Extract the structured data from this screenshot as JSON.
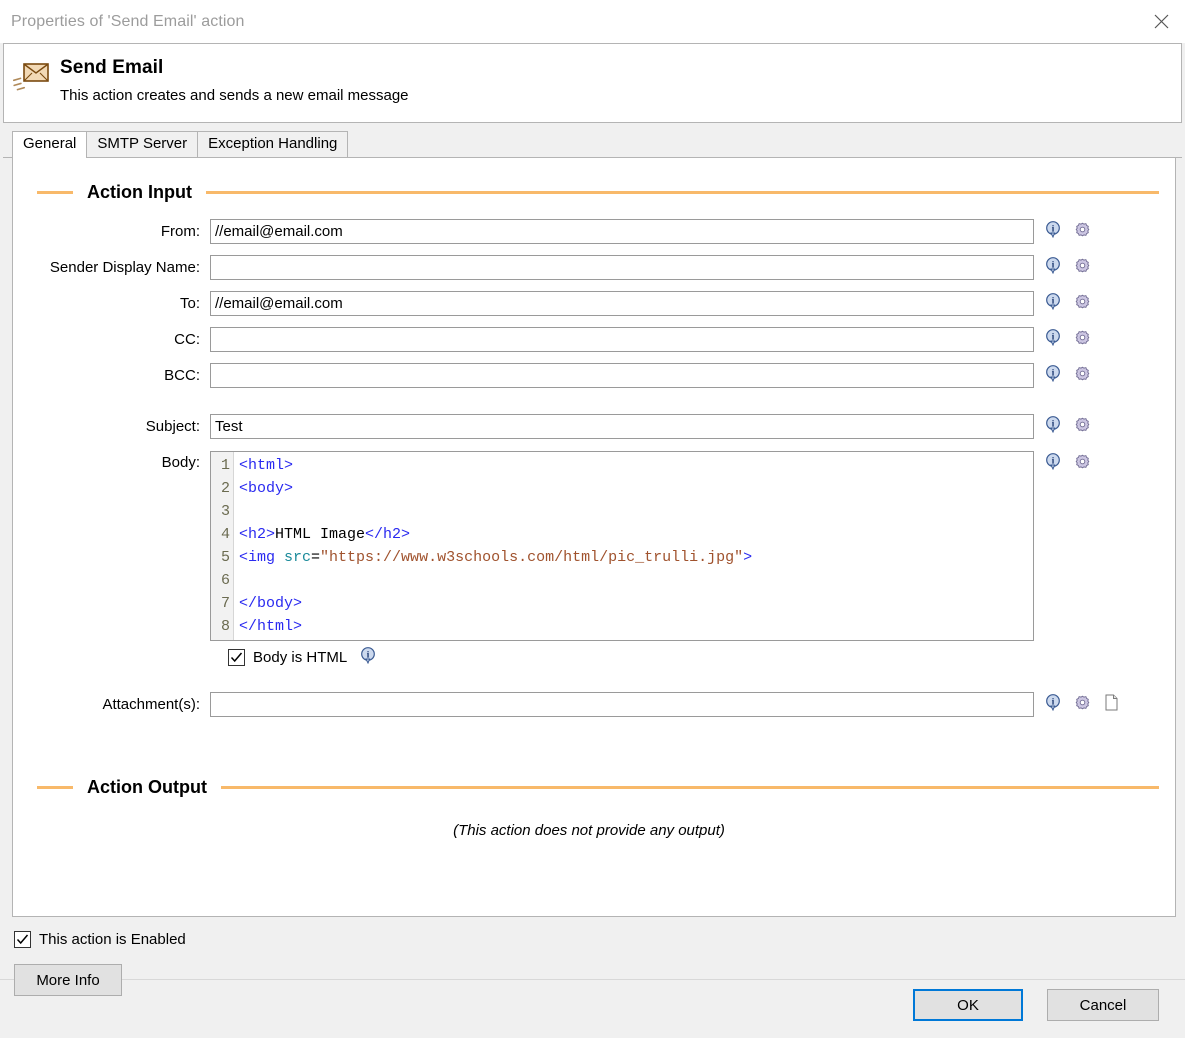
{
  "window": {
    "title": "Properties of 'Send Email' action",
    "close_label": "Close"
  },
  "header": {
    "icon": "send-email-envelope-icon",
    "title": "Send Email",
    "description": "This action creates and sends a new email message"
  },
  "tabs": [
    {
      "label": "General",
      "active": true
    },
    {
      "label": "SMTP Server",
      "active": false
    },
    {
      "label": "Exception Handling",
      "active": false
    }
  ],
  "action_input": {
    "section_title": "Action Input",
    "fields": [
      {
        "label": "From:",
        "value": "//email@email.com",
        "placeholder": "",
        "name": "from"
      },
      {
        "label": "Sender Display Name:",
        "value": "",
        "placeholder": "",
        "name": "sender-display-name"
      },
      {
        "label": "To:",
        "value": "//email@email.com",
        "placeholder": "",
        "name": "to"
      },
      {
        "label": "CC:",
        "value": "",
        "placeholder": "",
        "name": "cc"
      },
      {
        "label": "BCC:",
        "value": "",
        "placeholder": "",
        "name": "bcc"
      }
    ],
    "subject": {
      "label": "Subject:",
      "value": "Test",
      "placeholder": ""
    },
    "body": {
      "label": "Body:",
      "lines": [
        {
          "n": "1",
          "tokens": [
            {
              "t": "tag",
              "s": "<html>"
            }
          ]
        },
        {
          "n": "2",
          "tokens": [
            {
              "t": "tag",
              "s": "<body>"
            }
          ]
        },
        {
          "n": "3",
          "tokens": []
        },
        {
          "n": "4",
          "tokens": [
            {
              "t": "tag",
              "s": "<h2>"
            },
            {
              "t": "plain",
              "s": "HTML Image"
            },
            {
              "t": "tag",
              "s": "</h2>"
            }
          ]
        },
        {
          "n": "5",
          "tokens": [
            {
              "t": "tag",
              "s": "<img "
            },
            {
              "t": "attr",
              "s": "src"
            },
            {
              "t": "eq",
              "s": "="
            },
            {
              "t": "str",
              "s": "\"https://www.w3schools.com/html/pic_trulli.jpg\""
            },
            {
              "t": "tag",
              "s": ">"
            }
          ]
        },
        {
          "n": "6",
          "tokens": []
        },
        {
          "n": "7",
          "tokens": [
            {
              "t": "tag",
              "s": "</body>"
            }
          ]
        },
        {
          "n": "8",
          "tokens": [
            {
              "t": "tag",
              "s": "</html>"
            }
          ]
        }
      ]
    },
    "body_is_html": {
      "label": "Body is HTML",
      "checked": true
    },
    "attachments": {
      "label": "Attachment(s):",
      "value": "",
      "placeholder": ""
    }
  },
  "action_output": {
    "section_title": "Action Output",
    "note": "(This action does not provide any output)"
  },
  "footer": {
    "enabled_checkbox": {
      "label": "This action is Enabled",
      "checked": true
    },
    "more_info_label": "More Info",
    "ok_label": "OK",
    "cancel_label": "Cancel"
  },
  "colors": {
    "accent_rule": "#f8b96a",
    "focus_border": "#0078d7",
    "tag": "#2a2af0",
    "attr": "#1a8a9a",
    "string": "#a0522d",
    "title_text": "#9c9c9c"
  },
  "icons": {
    "info": "info-bubble-icon",
    "gear": "gear-icon",
    "file": "file-icon",
    "close": "close-icon",
    "check": "check-icon"
  }
}
